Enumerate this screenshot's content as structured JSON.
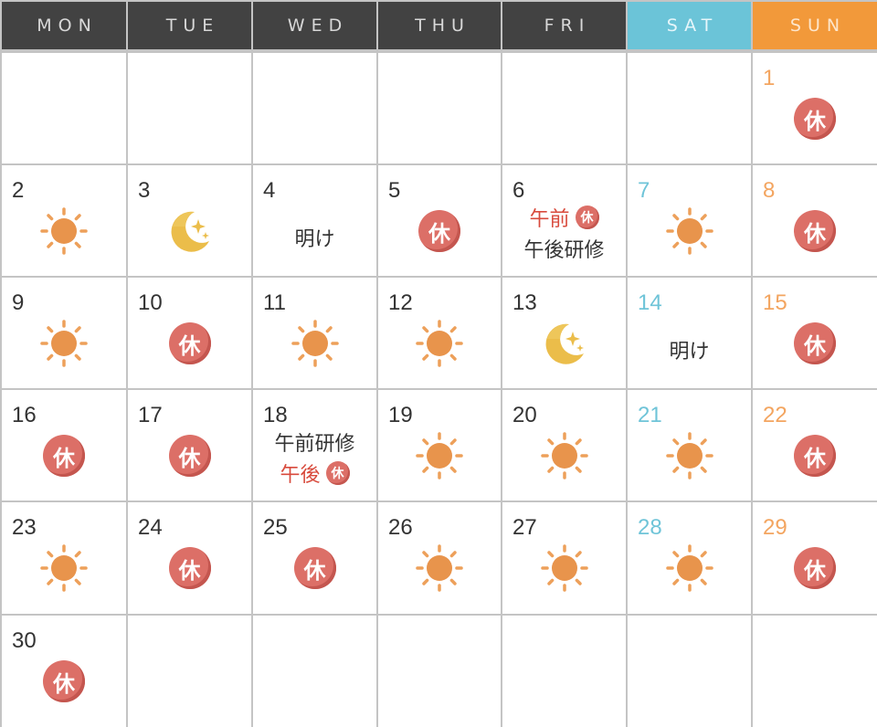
{
  "headers": [
    {
      "label": "MON",
      "bg": "#424242",
      "fg": "#d8d8d8"
    },
    {
      "label": "TUE",
      "bg": "#424242",
      "fg": "#d8d8d8"
    },
    {
      "label": "WED",
      "bg": "#424242",
      "fg": "#d8d8d8"
    },
    {
      "label": "THU",
      "bg": "#424242",
      "fg": "#d8d8d8"
    },
    {
      "label": "FRI",
      "bg": "#424242",
      "fg": "#d8d8d8"
    },
    {
      "label": "SAT",
      "bg": "#6bc4d8",
      "fg": "#e6f6fa"
    },
    {
      "label": "SUN",
      "bg": "#f2993a",
      "fg": "#fde6cc"
    }
  ],
  "colors": {
    "saturday": "#6fc4d8",
    "sunday": "#f3a560",
    "holiday_badge": "#dc6f67",
    "note_red": "#d84a3c",
    "sun_icon": "#e8924a",
    "moon_icon": "#ebbd4a"
  },
  "holiday_label": "休",
  "weeks": [
    [
      null,
      null,
      null,
      null,
      null,
      null,
      {
        "day": "1",
        "type": "off"
      }
    ],
    [
      {
        "day": "2",
        "type": "day"
      },
      {
        "day": "3",
        "type": "night"
      },
      {
        "day": "4",
        "type": "text",
        "lines": [
          {
            "text": "明け",
            "red": false
          }
        ]
      },
      {
        "day": "5",
        "type": "off"
      },
      {
        "day": "6",
        "type": "mixed",
        "lines": [
          {
            "text": "午前",
            "red": true,
            "badge": true
          },
          {
            "text": "午後研修",
            "red": false
          }
        ]
      },
      {
        "day": "7",
        "type": "day"
      },
      {
        "day": "8",
        "type": "off"
      }
    ],
    [
      {
        "day": "9",
        "type": "day"
      },
      {
        "day": "10",
        "type": "off"
      },
      {
        "day": "11",
        "type": "day"
      },
      {
        "day": "12",
        "type": "day"
      },
      {
        "day": "13",
        "type": "night"
      },
      {
        "day": "14",
        "type": "text",
        "lines": [
          {
            "text": "明け",
            "red": false
          }
        ]
      },
      {
        "day": "15",
        "type": "off"
      }
    ],
    [
      {
        "day": "16",
        "type": "off"
      },
      {
        "day": "17",
        "type": "off"
      },
      {
        "day": "18",
        "type": "mixed",
        "lines": [
          {
            "text": "午前研修",
            "red": false
          },
          {
            "text": "午後",
            "red": true,
            "badge": true
          }
        ]
      },
      {
        "day": "19",
        "type": "day"
      },
      {
        "day": "20",
        "type": "day"
      },
      {
        "day": "21",
        "type": "day"
      },
      {
        "day": "22",
        "type": "off"
      }
    ],
    [
      {
        "day": "23",
        "type": "day"
      },
      {
        "day": "24",
        "type": "off"
      },
      {
        "day": "25",
        "type": "off"
      },
      {
        "day": "26",
        "type": "day"
      },
      {
        "day": "27",
        "type": "day"
      },
      {
        "day": "28",
        "type": "day"
      },
      {
        "day": "29",
        "type": "off"
      }
    ],
    [
      {
        "day": "30",
        "type": "off"
      },
      null,
      null,
      null,
      null,
      null,
      null
    ]
  ]
}
